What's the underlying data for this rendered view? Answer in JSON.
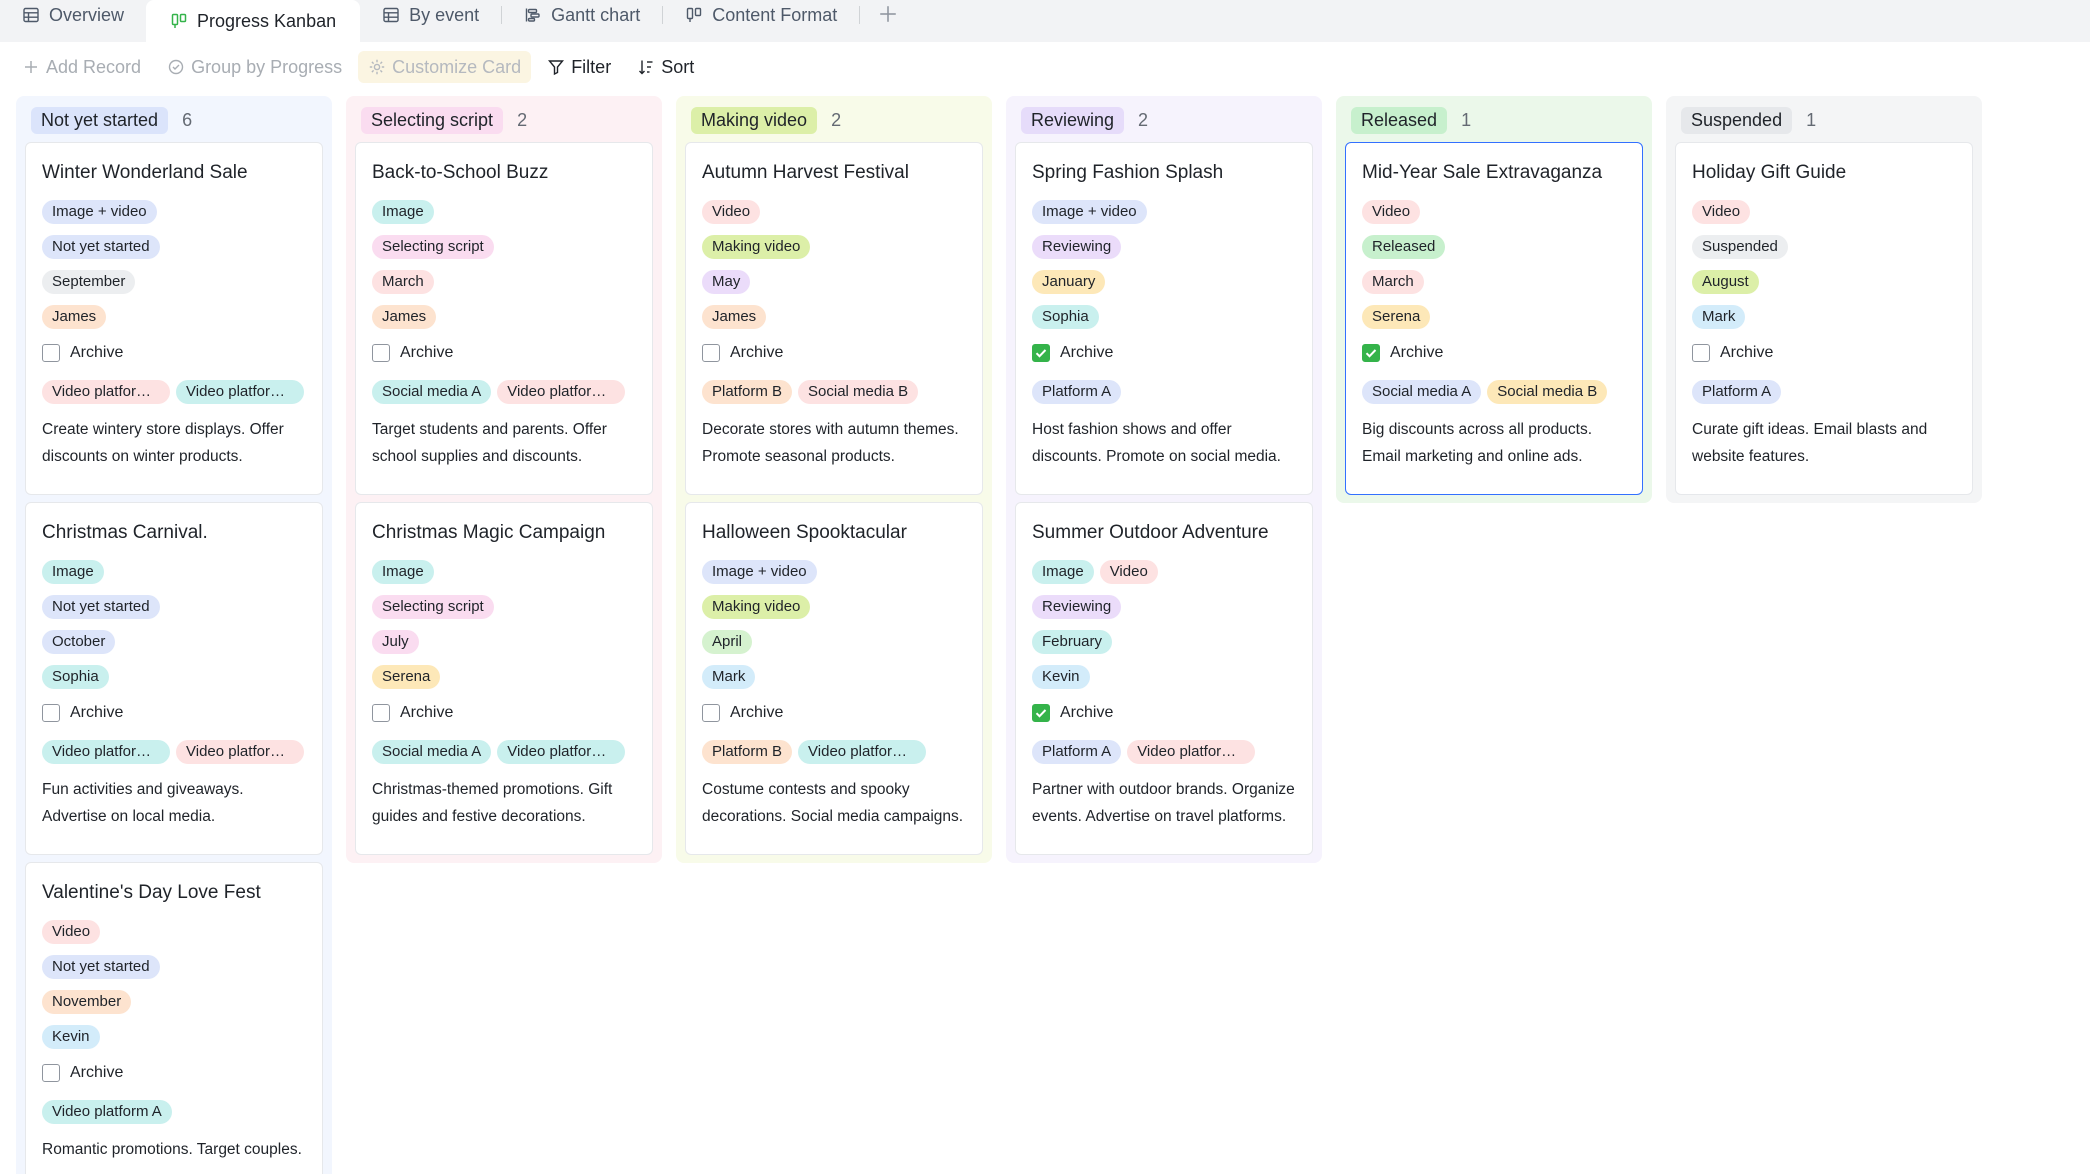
{
  "tabs": [
    {
      "label": "Overview",
      "icon": "table-icon",
      "active": false
    },
    {
      "label": "Progress Kanban",
      "icon": "kanban-icon",
      "active": true
    },
    {
      "label": "By event",
      "icon": "table-icon",
      "active": false
    },
    {
      "label": "Gantt chart",
      "icon": "gantt-icon",
      "active": false
    },
    {
      "label": "Content Format",
      "icon": "kanban-icon",
      "active": false
    }
  ],
  "toolbar": {
    "add_record": "Add Record",
    "group_by": "Group by Progress",
    "customize_card": "Customize Card",
    "filter": "Filter",
    "sort": "Sort"
  },
  "colors": {
    "tag_image_video": "#dde5fa",
    "tag_image": "#c9f0ee",
    "tag_video": "#fde2e2",
    "status_not_started": "#dde5fa",
    "status_selecting": "#fadcf0",
    "status_making": "#dcefa8",
    "status_reviewing": "#ebdcfa",
    "status_released": "#c7f0cd",
    "status_suspended": "#eceef0",
    "selected_border": "#3370ff",
    "checkbox_on": "#34b34a"
  },
  "columns": [
    {
      "title": "Not yet started",
      "count": "6",
      "bg": "blue",
      "title_bg": "#dbe4fb",
      "cards": [
        {
          "title": "Winter Wonderland Sale",
          "format": "Image + video",
          "format_color": "#dde5fa",
          "status": "Not yet started",
          "status_color": "#dde5fa",
          "month": "September",
          "month_color": "#eceef0",
          "owner": "James",
          "owner_color": "#fde3cf",
          "archive": false,
          "archive_label": "Archive",
          "platforms": [
            {
              "label": "Video platform B",
              "color": "#fde2e2"
            },
            {
              "label": "Video platform A",
              "color": "#c9f0ee"
            }
          ],
          "description": "Create wintery store displays. Offer discounts on winter products."
        },
        {
          "title": "Christmas Carnival.",
          "format": "Image",
          "format_color": "#c9f0ee",
          "status": "Not yet started",
          "status_color": "#dde5fa",
          "month": "October",
          "month_color": "#dde5fa",
          "owner": "Sophia",
          "owner_color": "#c9f0ee",
          "archive": false,
          "archive_label": "Archive",
          "platforms": [
            {
              "label": "Video platform A",
              "color": "#c9f0ee"
            },
            {
              "label": "Video platform B",
              "color": "#fde2e2"
            }
          ],
          "description": "Fun activities and giveaways. Advertise on local media."
        },
        {
          "title": "Valentine's Day Love Fest",
          "format": "Video",
          "format_color": "#fde2e2",
          "status": "Not yet started",
          "status_color": "#dde5fa",
          "month": "November",
          "month_color": "#fde3cf",
          "owner": "Kevin",
          "owner_color": "#d3ecfa",
          "archive": false,
          "archive_label": "Archive",
          "platforms": [
            {
              "label": "Video platform A",
              "color": "#c9f0ee"
            }
          ],
          "description": "Romantic promotions. Target couples."
        }
      ]
    },
    {
      "title": "Selecting script",
      "count": "2",
      "bg": "pink",
      "title_bg": "#fadcf0",
      "cards": [
        {
          "title": "Back-to-School Buzz",
          "format": "Image",
          "format_color": "#c9f0ee",
          "status": "Selecting script",
          "status_color": "#fadcf0",
          "month": "March",
          "month_color": "#fde2e2",
          "owner": "James",
          "owner_color": "#fde3cf",
          "archive": false,
          "archive_label": "Archive",
          "platforms": [
            {
              "label": "Social media A",
              "color": "#c9f0ee"
            },
            {
              "label": "Video platform B",
              "color": "#fde2e2"
            }
          ],
          "description": "Target students and parents. Offer school supplies and discounts."
        },
        {
          "title": "Christmas Magic Campaign",
          "format": "Image",
          "format_color": "#c9f0ee",
          "status": "Selecting script",
          "status_color": "#fadcf0",
          "month": "July",
          "month_color": "#fadcf0",
          "owner": "Serena",
          "owner_color": "#fde8b8",
          "archive": false,
          "archive_label": "Archive",
          "platforms": [
            {
              "label": "Social media A",
              "color": "#c9f0ee"
            },
            {
              "label": "Video platform A",
              "color": "#c9f0ee"
            }
          ],
          "description": "Christmas-themed promotions. Gift guides and festive decorations."
        }
      ]
    },
    {
      "title": "Making video",
      "count": "2",
      "bg": "yellow",
      "title_bg": "#dcefa8",
      "cards": [
        {
          "title": "Autumn Harvest Festival",
          "format": "Video",
          "format_color": "#fde2e2",
          "status": "Making video",
          "status_color": "#dcefa8",
          "month": "May",
          "month_color": "#ebdcfa",
          "owner": "James",
          "owner_color": "#fde3cf",
          "archive": false,
          "archive_label": "Archive",
          "platforms": [
            {
              "label": "Platform B",
              "color": "#fde3cf"
            },
            {
              "label": "Social media B",
              "color": "#fde2e2"
            }
          ],
          "description": "Decorate stores with autumn themes. Promote seasonal products."
        },
        {
          "title": "Halloween Spooktacular",
          "format": "Image + video",
          "format_color": "#dde5fa",
          "status": "Making video",
          "status_color": "#dcefa8",
          "month": "April",
          "month_color": "#d5f2cf",
          "owner": "Mark",
          "owner_color": "#d3ecfa",
          "archive": false,
          "archive_label": "Archive",
          "platforms": [
            {
              "label": "Platform B",
              "color": "#fde3cf"
            },
            {
              "label": "Video platform A",
              "color": "#c9f0ee"
            }
          ],
          "description": "Costume contests and spooky decorations. Social media campaigns."
        }
      ]
    },
    {
      "title": "Reviewing",
      "count": "2",
      "bg": "purple",
      "title_bg": "#e6dcfa",
      "cards": [
        {
          "title": "Spring Fashion Splash",
          "format": "Image + video",
          "format_color": "#dde5fa",
          "status": "Reviewing",
          "status_color": "#ebdcfa",
          "month": "January",
          "month_color": "#fde8b8",
          "owner": "Sophia",
          "owner_color": "#c9f0ee",
          "archive": true,
          "archive_label": "Archive",
          "platforms": [
            {
              "label": "Platform A",
              "color": "#dde5fa"
            }
          ],
          "description": "Host fashion shows and offer discounts. Promote on social media."
        },
        {
          "title": "Summer Outdoor Adventure",
          "format": "Image",
          "format_color": "#c9f0ee",
          "format2": "Video",
          "format2_color": "#fde2e2",
          "status": "Reviewing",
          "status_color": "#ebdcfa",
          "month": "February",
          "month_color": "#c9f0ee",
          "owner": "Kevin",
          "owner_color": "#d3ecfa",
          "archive": true,
          "archive_label": "Archive",
          "platforms": [
            {
              "label": "Platform A",
              "color": "#dde5fa"
            },
            {
              "label": "Video platform B",
              "color": "#fde2e2"
            }
          ],
          "description": "Partner with outdoor brands. Organize events. Advertise on travel platforms."
        }
      ]
    },
    {
      "title": "Released",
      "count": "1",
      "bg": "green",
      "title_bg": "#c7f0cd",
      "cards": [
        {
          "title": "Mid-Year Sale Extravaganza",
          "format": "Video",
          "format_color": "#fde2e2",
          "status": "Released",
          "status_color": "#c7f0cd",
          "month": "March",
          "month_color": "#fde2e2",
          "owner": "Serena",
          "owner_color": "#fde8b8",
          "archive": true,
          "archive_label": "Archive",
          "selected": true,
          "platforms": [
            {
              "label": "Social media A",
              "color": "#dde5fa"
            },
            {
              "label": "Social media B",
              "color": "#fde8b8"
            }
          ],
          "description": "Big discounts across all products. Email marketing and online ads."
        }
      ]
    },
    {
      "title": "Suspended",
      "count": "1",
      "bg": "gray",
      "title_bg": "#e6e8eb",
      "cards": [
        {
          "title": "Holiday Gift Guide",
          "format": "Video",
          "format_color": "#fde2e2",
          "status": "Suspended",
          "status_color": "#eceef0",
          "month": "August",
          "month_color": "#dcefa8",
          "owner": "Mark",
          "owner_color": "#d3ecfa",
          "archive": false,
          "archive_label": "Archive",
          "platforms": [
            {
              "label": "Platform A",
              "color": "#dde5fa"
            }
          ],
          "description": "Curate gift ideas. Email blasts and website features."
        }
      ]
    }
  ]
}
